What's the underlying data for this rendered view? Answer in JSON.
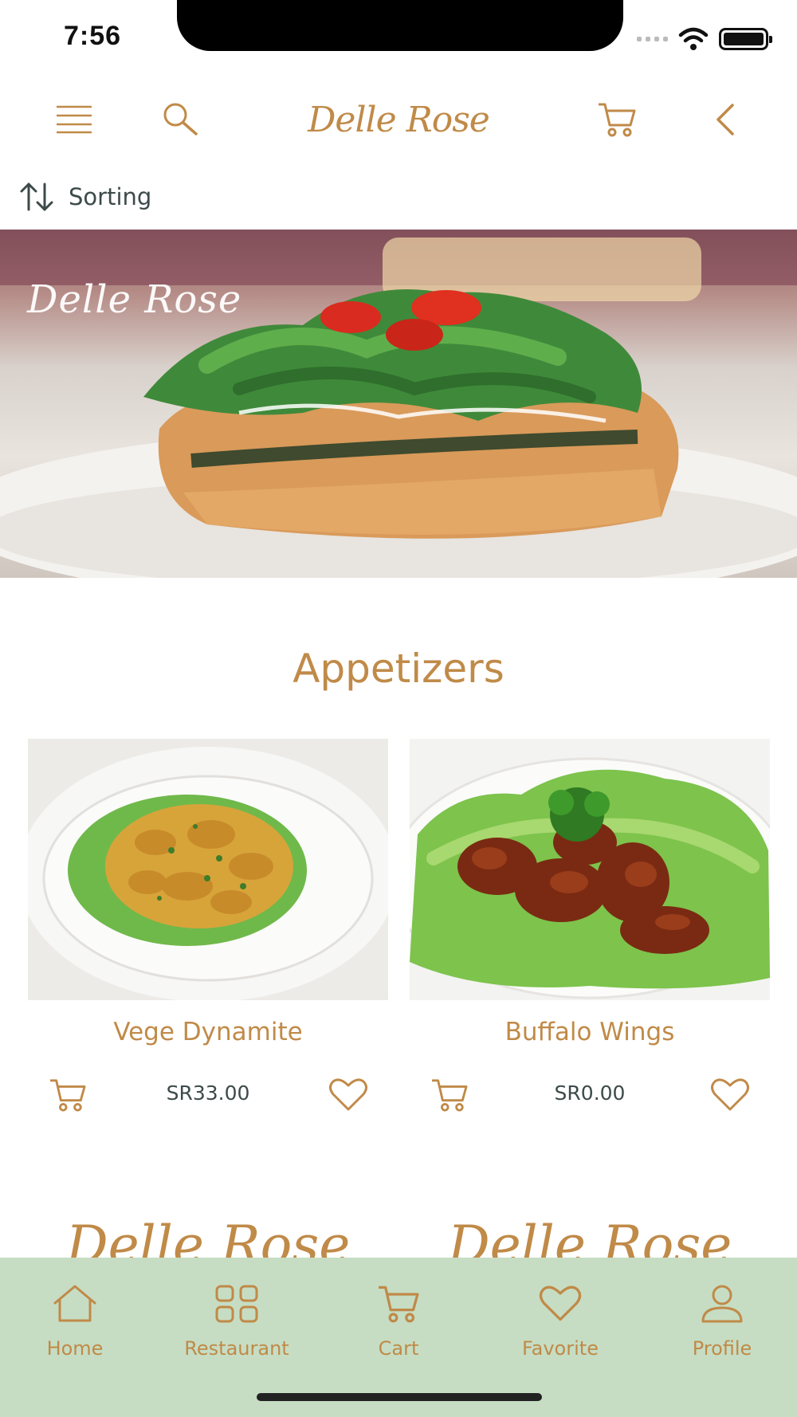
{
  "status_bar": {
    "time": "7:56"
  },
  "header": {
    "logo_text": "Delle Rose",
    "icons": [
      "menu-icon",
      "search-icon",
      "cart-icon",
      "back-icon"
    ]
  },
  "sorting": {
    "label": "Sorting",
    "icon": "sort-icon"
  },
  "banner": {
    "overlay_text": "Delle Rose"
  },
  "category": {
    "title": "Appetizers"
  },
  "products": [
    {
      "name": "Vege Dynamite",
      "price": "SR33.00"
    },
    {
      "name": "Buffalo Wings",
      "price": "SR0.00"
    }
  ],
  "next_row": {
    "logo_text": "Delle Rose"
  },
  "tabs": [
    {
      "label": "Home",
      "icon": "home-icon"
    },
    {
      "label": "Restaurant",
      "icon": "grid-icon"
    },
    {
      "label": "Cart",
      "icon": "cart-icon"
    },
    {
      "label": "Favorite",
      "icon": "heart-icon"
    },
    {
      "label": "Profile",
      "icon": "user-icon"
    }
  ],
  "colors": {
    "accent": "#c08a48",
    "tab_bar_bg": "#c6ddc3",
    "text_dark": "#3e4a4a"
  }
}
